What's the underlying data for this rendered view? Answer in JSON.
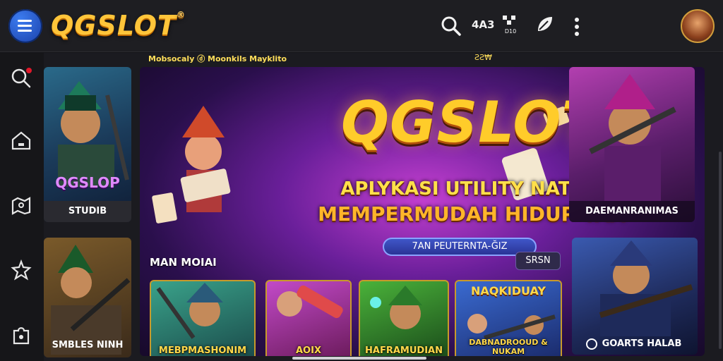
{
  "app": {
    "title": "QGSLOT",
    "trademark": "®"
  },
  "topbar": {
    "icons": [
      "search-icon",
      "text-size-icon",
      "qr-icon",
      "leaf-icon",
      "more-vertical-icon"
    ],
    "text_size_label": "4A3",
    "qr_label": "D10"
  },
  "sidebar": {
    "icons": [
      "search-icon",
      "home-icon",
      "map-icon",
      "star-icon",
      "puzzle-icon"
    ]
  },
  "strip": {
    "left": "Mobsocaly  ⓓ Moonkils Mayklito",
    "right": "ƧƧ₩"
  },
  "left_cards": [
    {
      "title": "QGSLOP",
      "label": "STUDIB"
    },
    {
      "label": "SMBLES NINH"
    }
  ],
  "hero": {
    "title": "QGSLOT",
    "subtitle1": "APLYKASI UTILITY NATUR",
    "subtitle2": "MEMPERMUDAH HIDUP YAA",
    "button": "7AN PEUTERNTA-ĞIZ"
  },
  "section": {
    "label": "MAN MOIAI",
    "see_all": "SRSN"
  },
  "games": [
    {
      "label": "MEBPMASHONIM",
      "color": "#2a6a6a"
    },
    {
      "label": "AOIX",
      "color": "#8a2a6a"
    },
    {
      "label": "HAFRAMUDIAN",
      "color": "#2a7a2a"
    },
    {
      "title": "NAQKIDUAY",
      "label": "DABNADROOUD & NUKAM",
      "color": "#3a5ab0"
    }
  ],
  "right_cards": [
    {
      "label": "DAEMANRANIMAS"
    },
    {
      "label": "GOARTS HALAB"
    }
  ],
  "colors": {
    "accent": "#ffc53a",
    "background": "#141418",
    "hero": "#6a1f9a"
  }
}
